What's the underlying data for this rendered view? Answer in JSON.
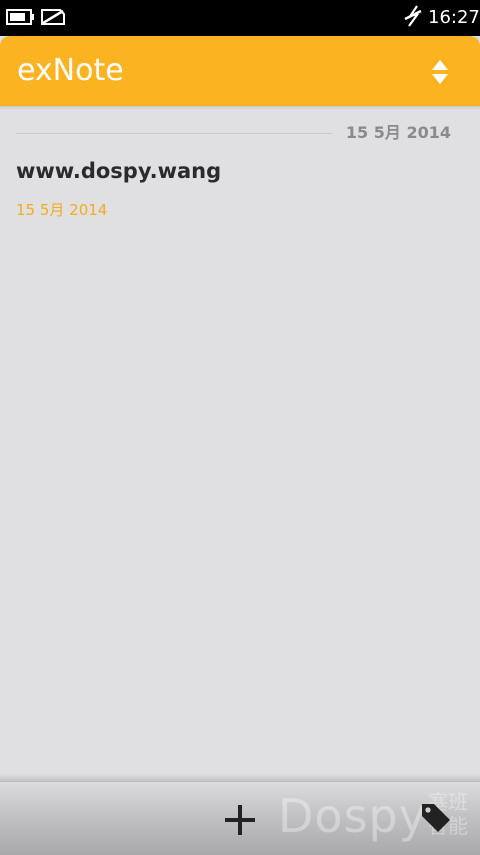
{
  "status_bar": {
    "time": "16:27",
    "battery_icon": "battery-icon",
    "sim_icon": "no-sim-icon",
    "signal_icon": "signal-icon"
  },
  "header": {
    "title": "exNote",
    "sort_icon": "sort-arrows-icon",
    "color": "#fbb321"
  },
  "notes_list": {
    "section_date": "15 5月 2014",
    "items": [
      {
        "title": "www.dospy.wang",
        "date": "15 5月 2014"
      }
    ]
  },
  "toolbar": {
    "add_icon": "plus-icon",
    "tag_icon": "tag-icon",
    "watermark": "Dospy",
    "watermark_cn": "塞班智能"
  },
  "colors": {
    "accent": "#fbb321",
    "background": "#e0e0e3",
    "date_accent": "#f2ac1c"
  }
}
